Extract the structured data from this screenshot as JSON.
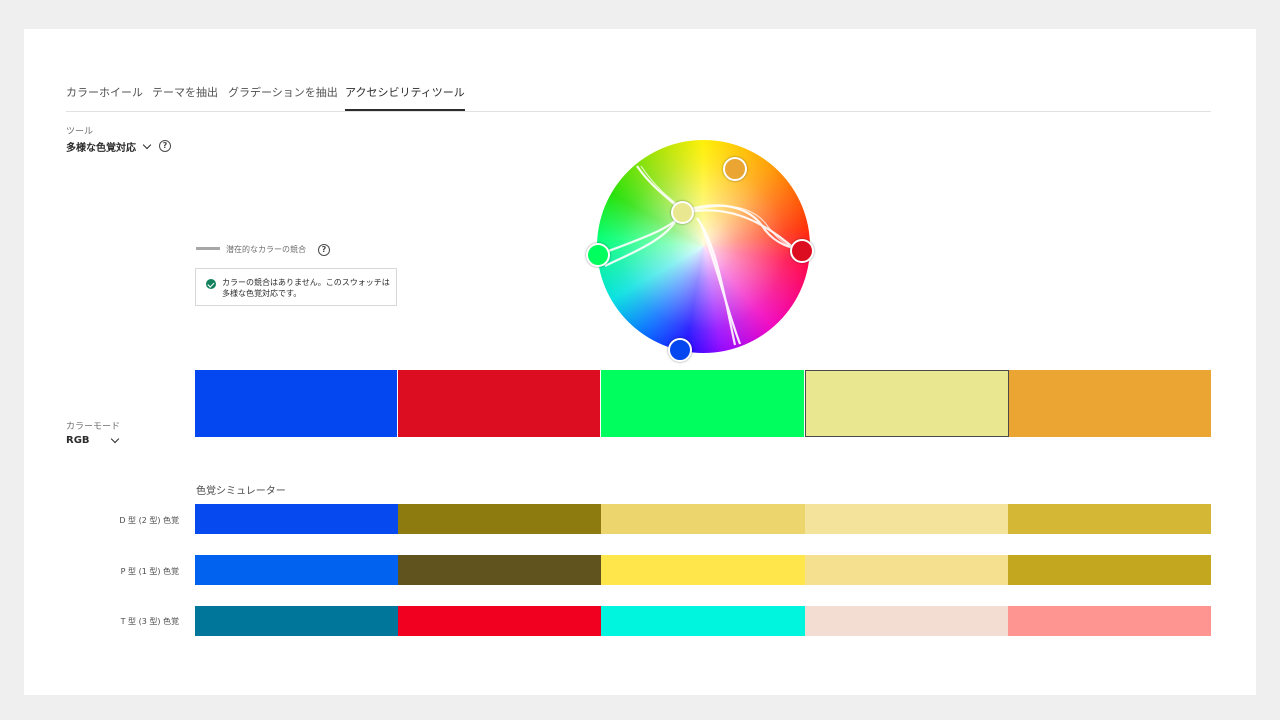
{
  "tabs": [
    {
      "label": "カラーホイール"
    },
    {
      "label": "テーマを抽出"
    },
    {
      "label": "グラデーションを抽出"
    },
    {
      "label": "アクセシビリティツール"
    }
  ],
  "tool": {
    "label": "ツール",
    "value": "多様な色覚対応",
    "help_icon": "help-icon"
  },
  "legend": {
    "text": "潜在的なカラーの競合",
    "help_icon": "help-icon"
  },
  "status": {
    "icon": "check-circle-icon",
    "text": "カラーの競合はありません。このスウォッチは多様な色覚対応です。",
    "color": "#12805c"
  },
  "color_mode": {
    "label": "カラーモード",
    "value": "RGB"
  },
  "swatches": [
    "#0446ef",
    "#dc0c21",
    "#00ff5e",
    "#e9e891",
    "#eaa532"
  ],
  "selected_swatch": 3,
  "simulator": {
    "title": "色覚シミュレーター",
    "rows": [
      {
        "label": "D 型 (2 型) 色覚",
        "colors": [
          "#0549ef",
          "#8d7b10",
          "#ecd56c",
          "#f4e39a",
          "#d4b734"
        ]
      },
      {
        "label": "P 型 (1 型) 色覚",
        "colors": [
          "#0262f0",
          "#61531d",
          "#ffe64a",
          "#f5e090",
          "#c3a81f"
        ]
      },
      {
        "label": "T 型 (3 型) 色覚",
        "colors": [
          "#00769b",
          "#f1001f",
          "#00f5de",
          "#f3dcd1",
          "#fe9590"
        ]
      }
    ]
  }
}
